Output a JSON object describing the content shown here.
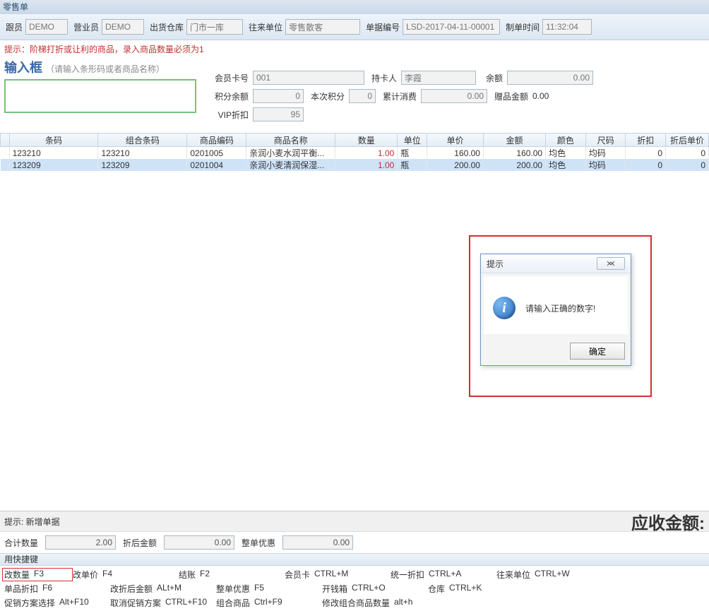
{
  "window_title": "零售单",
  "toolbar": {
    "clerk_lbl": "跟员",
    "clerk_val": "DEMO",
    "sales_lbl": "营业员",
    "sales_val": "DEMO",
    "wh_lbl": "出货仓库",
    "wh_val": "门市一库",
    "cust_lbl": "往来单位",
    "cust_val": "零售散客",
    "bill_lbl": "单据编号",
    "bill_val": "LSD-2017-04-11-00001",
    "time_lbl": "制单时间",
    "time_val": "11:32:04"
  },
  "tip": "提示：阶梯打折或让利的商品，录入商品数量必须为1",
  "inputbox": {
    "title": "输入框",
    "sub": "（请输入条形码或者商品名称）"
  },
  "member": {
    "card_lbl": "会员卡号",
    "card_val": "001",
    "holder_lbl": "持卡人",
    "holder_val": "李霞",
    "balance_lbl": "余额",
    "balance_val": "0.00",
    "ptsbal_lbl": "积分余额",
    "ptsbal_val": "0",
    "ptsnow_lbl": "本次积分",
    "ptsnow_val": "0",
    "cumul_lbl": "累计消费",
    "cumul_val": "0.00",
    "gift_lbl": "赠品金额",
    "gift_val": "0.00",
    "vip_lbl": "VIP折扣",
    "vip_val": "95"
  },
  "grid": {
    "headers": [
      "",
      "条码",
      "组合条码",
      "商品编码",
      "商品名称",
      "数量",
      "单位",
      "单价",
      "金额",
      "颜色",
      "尺码",
      "折扣",
      "折后单价"
    ],
    "rows": [
      {
        "barcode": "123210",
        "combo": "123210",
        "code": "0201005",
        "name": "亲润小麦水润平衡...",
        "qty": "1.00",
        "unit": "瓶",
        "price": "160.00",
        "amount": "160.00",
        "color": "均色",
        "size": "均码",
        "disc": "0",
        "aft": "0"
      },
      {
        "barcode": "123209",
        "combo": "123209",
        "code": "0201004",
        "name": "亲润小麦清润保湿...",
        "qty": "1.00",
        "unit": "瓶",
        "price": "200.00",
        "amount": "200.00",
        "color": "均色",
        "size": "均码",
        "disc": "0",
        "aft": "0"
      }
    ]
  },
  "dialog": {
    "title": "提示",
    "msg": "请输入正确的数字!",
    "ok": "确定"
  },
  "status": {
    "left": "提示: 新增单据",
    "right": "应收金额:"
  },
  "totals": {
    "qty_lbl": "合计数量",
    "qty_val": "2.00",
    "aft_lbl": "折后金额",
    "aft_val": "0.00",
    "whole_lbl": "整单优惠",
    "whole_val": "0.00"
  },
  "sc_hdr": "用快捷键",
  "shortcuts": {
    "r1": [
      {
        "n": "改数量",
        "k": "F3",
        "hl": true
      },
      {
        "n": "改单价",
        "k": "F4"
      },
      {
        "n": "结账",
        "k": "F2"
      },
      {
        "n": "会员卡",
        "k": "CTRL+M"
      },
      {
        "n": "统一折扣",
        "k": "CTRL+A"
      },
      {
        "n": "往来单位",
        "k": "CTRL+W"
      }
    ],
    "r2": [
      {
        "n": "单品折扣",
        "k": "F6"
      },
      {
        "n": "改折后金额",
        "k": "ALt+M"
      },
      {
        "n": "整单优惠",
        "k": "F5"
      },
      {
        "n": "开钱箱",
        "k": "CTRL+O"
      },
      {
        "n": "仓库",
        "k": "CTRL+K"
      }
    ],
    "r3": [
      {
        "n": "促销方案选择",
        "k": "Alt+F10"
      },
      {
        "n": "取消促销方案",
        "k": "CTRL+F10"
      },
      {
        "n": "组合商品",
        "k": "Ctrl+F9"
      },
      {
        "n": "修改组合商品数量",
        "k": "alt+h"
      }
    ]
  }
}
